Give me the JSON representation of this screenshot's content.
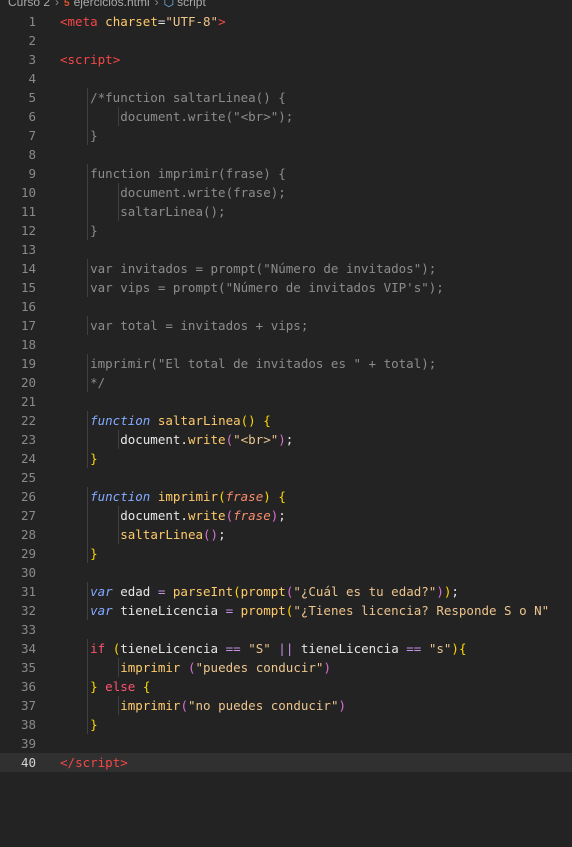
{
  "breadcrumb": {
    "folder": "Curso 2",
    "file": "ejercicios.html",
    "symbol": "script"
  },
  "editor": {
    "current_line": 40,
    "lines": [
      {
        "n": "1",
        "tokens": [
          [
            "tag",
            "<"
          ],
          [
            "tag",
            "meta"
          ],
          [
            "plain",
            " "
          ],
          [
            "attr",
            "charset"
          ],
          [
            "plain",
            "="
          ],
          [
            "str",
            "\"UTF-8\""
          ],
          [
            "tag",
            ">"
          ]
        ]
      },
      {
        "n": "2",
        "tokens": []
      },
      {
        "n": "3",
        "tokens": [
          [
            "tag",
            "<"
          ],
          [
            "tag",
            "script"
          ],
          [
            "tag",
            ">"
          ]
        ]
      },
      {
        "n": "4",
        "tokens": []
      },
      {
        "n": "5",
        "tokens": [
          [
            "com",
            "    /*function saltarLinea() {"
          ]
        ]
      },
      {
        "n": "6",
        "tokens": [
          [
            "com",
            "        document.write(\"<br>\");"
          ]
        ]
      },
      {
        "n": "7",
        "tokens": [
          [
            "com",
            "    }"
          ]
        ]
      },
      {
        "n": "8",
        "tokens": []
      },
      {
        "n": "9",
        "tokens": [
          [
            "com",
            "    function imprimir(frase) {"
          ]
        ]
      },
      {
        "n": "10",
        "tokens": [
          [
            "com",
            "        document.write(frase);"
          ]
        ]
      },
      {
        "n": "11",
        "tokens": [
          [
            "com",
            "        saltarLinea();"
          ]
        ]
      },
      {
        "n": "12",
        "tokens": [
          [
            "com",
            "    }"
          ]
        ]
      },
      {
        "n": "13",
        "tokens": []
      },
      {
        "n": "14",
        "tokens": [
          [
            "com",
            "    var invitados = prompt(\"Número de invitados\");"
          ]
        ]
      },
      {
        "n": "15",
        "tokens": [
          [
            "com",
            "    var vips = prompt(\"Número de invitados VIP's\");"
          ]
        ]
      },
      {
        "n": "16",
        "tokens": []
      },
      {
        "n": "17",
        "tokens": [
          [
            "com",
            "    var total = invitados + vips;"
          ]
        ]
      },
      {
        "n": "18",
        "tokens": []
      },
      {
        "n": "19",
        "tokens": [
          [
            "com",
            "    imprimir(\"El total de invitados es \" + total);"
          ]
        ]
      },
      {
        "n": "20",
        "tokens": [
          [
            "com",
            "    */"
          ]
        ]
      },
      {
        "n": "21",
        "tokens": []
      },
      {
        "n": "22",
        "tokens": [
          [
            "plain",
            "    "
          ],
          [
            "kw",
            "function"
          ],
          [
            "plain",
            " "
          ],
          [
            "fn",
            "saltarLinea"
          ],
          [
            "brace",
            "()"
          ],
          [
            "plain",
            " "
          ],
          [
            "brace",
            "{"
          ]
        ]
      },
      {
        "n": "23",
        "tokens": [
          [
            "plain",
            "        document."
          ],
          [
            "fn",
            "write"
          ],
          [
            "paren2",
            "("
          ],
          [
            "str",
            "\"<br>\""
          ],
          [
            "paren2",
            ")"
          ],
          [
            "plain",
            ";"
          ]
        ]
      },
      {
        "n": "24",
        "tokens": [
          [
            "plain",
            "    "
          ],
          [
            "brace",
            "}"
          ]
        ]
      },
      {
        "n": "25",
        "tokens": []
      },
      {
        "n": "26",
        "tokens": [
          [
            "plain",
            "    "
          ],
          [
            "kw",
            "function"
          ],
          [
            "plain",
            " "
          ],
          [
            "fn",
            "imprimir"
          ],
          [
            "brace",
            "("
          ],
          [
            "param",
            "frase"
          ],
          [
            "brace",
            ")"
          ],
          [
            "plain",
            " "
          ],
          [
            "brace",
            "{"
          ]
        ]
      },
      {
        "n": "27",
        "tokens": [
          [
            "plain",
            "        document."
          ],
          [
            "fn",
            "write"
          ],
          [
            "paren2",
            "("
          ],
          [
            "param",
            "frase"
          ],
          [
            "paren2",
            ")"
          ],
          [
            "plain",
            ";"
          ]
        ]
      },
      {
        "n": "28",
        "tokens": [
          [
            "plain",
            "        "
          ],
          [
            "fn",
            "saltarLinea"
          ],
          [
            "paren2",
            "()"
          ],
          [
            "plain",
            ";"
          ]
        ]
      },
      {
        "n": "29",
        "tokens": [
          [
            "plain",
            "    "
          ],
          [
            "brace",
            "}"
          ]
        ]
      },
      {
        "n": "30",
        "tokens": []
      },
      {
        "n": "31",
        "tokens": [
          [
            "plain",
            "    "
          ],
          [
            "kw",
            "var"
          ],
          [
            "plain",
            " edad "
          ],
          [
            "op",
            "="
          ],
          [
            "plain",
            " "
          ],
          [
            "fn",
            "parseInt"
          ],
          [
            "brace",
            "("
          ],
          [
            "fn",
            "prompt"
          ],
          [
            "paren2",
            "("
          ],
          [
            "str",
            "\"¿Cuál es tu edad?\""
          ],
          [
            "paren2",
            ")"
          ],
          [
            "brace",
            ")"
          ],
          [
            "plain",
            ";"
          ]
        ]
      },
      {
        "n": "32",
        "tokens": [
          [
            "plain",
            "    "
          ],
          [
            "kw",
            "var"
          ],
          [
            "plain",
            " tieneLicencia "
          ],
          [
            "op",
            "="
          ],
          [
            "plain",
            " "
          ],
          [
            "fn",
            "prompt"
          ],
          [
            "brace",
            "("
          ],
          [
            "str",
            "\"¿Tienes licencia? Responde S o N\""
          ]
        ]
      },
      {
        "n": "33",
        "tokens": []
      },
      {
        "n": "34",
        "tokens": [
          [
            "plain",
            "    "
          ],
          [
            "ctl",
            "if"
          ],
          [
            "plain",
            " "
          ],
          [
            "brace",
            "("
          ],
          [
            "plain",
            "tieneLicencia "
          ],
          [
            "op",
            "=="
          ],
          [
            "plain",
            " "
          ],
          [
            "str",
            "\"S\""
          ],
          [
            "plain",
            " "
          ],
          [
            "op",
            "||"
          ],
          [
            "plain",
            " tieneLicencia "
          ],
          [
            "op",
            "=="
          ],
          [
            "plain",
            " "
          ],
          [
            "str",
            "\"s\""
          ],
          [
            "brace",
            ")"
          ],
          [
            "brace",
            "{"
          ]
        ]
      },
      {
        "n": "35",
        "tokens": [
          [
            "plain",
            "        "
          ],
          [
            "fn",
            "imprimir"
          ],
          [
            "plain",
            " "
          ],
          [
            "paren2",
            "("
          ],
          [
            "str",
            "\"puedes conducir\""
          ],
          [
            "paren2",
            ")"
          ]
        ]
      },
      {
        "n": "36",
        "tokens": [
          [
            "plain",
            "    "
          ],
          [
            "brace",
            "}"
          ],
          [
            "plain",
            " "
          ],
          [
            "ctl",
            "else"
          ],
          [
            "plain",
            " "
          ],
          [
            "brace",
            "{"
          ]
        ]
      },
      {
        "n": "37",
        "tokens": [
          [
            "plain",
            "        "
          ],
          [
            "fn",
            "imprimir"
          ],
          [
            "paren2",
            "("
          ],
          [
            "str",
            "\"no puedes conducir\""
          ],
          [
            "paren2",
            ")"
          ]
        ]
      },
      {
        "n": "38",
        "tokens": [
          [
            "plain",
            "    "
          ],
          [
            "brace",
            "}"
          ]
        ]
      },
      {
        "n": "39",
        "tokens": []
      },
      {
        "n": "40",
        "tokens": [
          [
            "tag",
            "</"
          ],
          [
            "tag",
            "script"
          ],
          [
            "tag",
            ">"
          ]
        ]
      }
    ]
  }
}
